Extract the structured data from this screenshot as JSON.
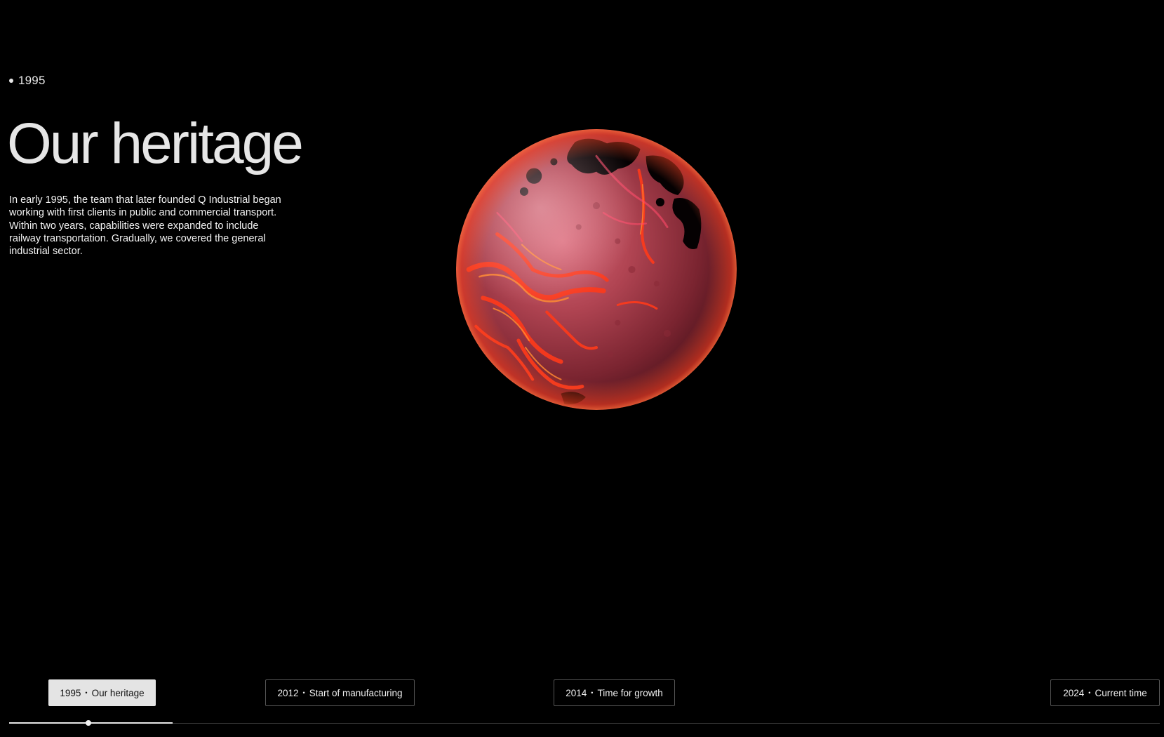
{
  "header": {
    "current_year": "1995"
  },
  "hero": {
    "title": "Our heritage",
    "description": "In early 1995, the team that later founded Q Industrial began working with first clients in public and commercial transport. Within two years, capabilities were expanded to include railway transportation. Gradually, we covered the general industrial sector."
  },
  "visual": {
    "icon": "glowing-red-planet",
    "colors": {
      "base": "#a83a45",
      "glow": "#ff3a1a",
      "highlight": "#f0a0a8"
    }
  },
  "timeline": {
    "separator": "•",
    "items": [
      {
        "year": "1995",
        "label": "Our heritage",
        "active": true
      },
      {
        "year": "2012",
        "label": "Start of manufacturing",
        "active": false
      },
      {
        "year": "2014",
        "label": "Time for growth",
        "active": false
      },
      {
        "year": "2024",
        "label": "Current time",
        "active": false
      }
    ],
    "progress_fraction": 0.142,
    "handle_fraction": 0.069
  },
  "colors": {
    "background": "#000000",
    "text": "#e6e6e6",
    "active_button_bg": "#e4e4e4",
    "button_border": "#555555"
  }
}
